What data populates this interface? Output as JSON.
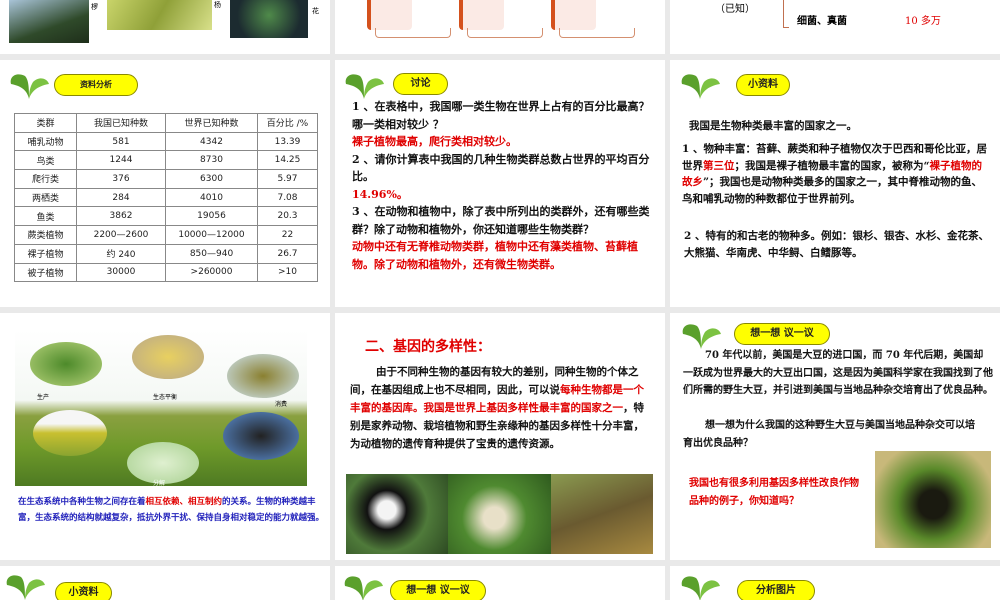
{
  "row1": {
    "slide1": {
      "labels": [
        "椤",
        "杨",
        "花"
      ]
    },
    "slide3": {
      "known": "（已知）",
      "item": "细菌、真菌",
      "count": "10 多万"
    }
  },
  "slide_table": {
    "badge": "资料分析",
    "headers": [
      "类群",
      "我国已知种数",
      "世界已知种数",
      "百分比 /%"
    ],
    "rows": [
      [
        "哺乳动物",
        "581",
        "4342",
        "13.39"
      ],
      [
        "鸟类",
        "1244",
        "8730",
        "14.25"
      ],
      [
        "爬行类",
        "376",
        "6300",
        "5.97"
      ],
      [
        "两栖类",
        "284",
        "4010",
        "7.08"
      ],
      [
        "鱼类",
        "3862",
        "19056",
        "20.3"
      ],
      [
        "蕨类植物",
        "2200—2600",
        "10000—12000",
        "22"
      ],
      [
        "裸子植物",
        "约 240",
        "850—940",
        "26.7"
      ],
      [
        "被子植物",
        "30000",
        ">260000",
        ">10"
      ]
    ]
  },
  "slide_discuss": {
    "badge": "讨论",
    "q1": "1 、在表格中，我国哪一类生物在世界上占有的百分比最高？哪一类相对较少 ？",
    "a1": "裸子植物最高，爬行类相对较少。",
    "q2": "2 、请你计算表中我国的几种生物类群总数占世界的平均百分比。",
    "a2": "14.96%。",
    "q3": "3 、在动物和植物中，除了表中所列出的类群外，还有哪些类群？除了动物和植物外，你还知道哪些生物类群？",
    "a3": "动物中还有无脊椎动物类群，植物中还有藻类植物、苔藓植物。除了动物和植物外，还有微生物类群。"
  },
  "slide_info": {
    "badge": "小资料",
    "intro": "我国是生物种类最丰富的国家之一。",
    "p1a": "1 、物种丰富：苔藓、蕨类和种子植物仅次于巴西和哥伦比亚，居世界",
    "p1b": "第三位",
    "p1c": "；我国是裸子植物最丰富的国家，被称为“",
    "p1d": "裸子植物的故乡",
    "p1e": "”；我国也是动物种类最多的国家之一，其中脊椎动物的鱼、鸟和哺乳动物的种数都位于世界前列。",
    "p2": "2 、特有的和古老的物种多。例如：银杉、银杏、水杉、金花茶、大熊猫、华南虎、中华鲟、白鳍豚等。"
  },
  "slide_eco": {
    "labels": {
      "producer": "生产",
      "balance": "生态平衡",
      "consumer": "消费",
      "decomposer": "分解"
    },
    "cap_a": "在生态系统中各种生物之间存在着",
    "cap_b": "相互依赖、相互制约",
    "cap_c": "的关系。生物的种类越丰富，生态系统的结构就越复杂，抵抗外界干扰、保持自身相对稳定的能力就越强。"
  },
  "slide_gene": {
    "title": "二、基因的多样性：",
    "p_a": "由于不同种生物的基因有较大的差别，同种生物的个体之间，在基因组成上也不尽相同，因此，可以说",
    "p_b": "每种生物都是一个丰富的基因库。我国是世界上基因多样性最丰富的国家之一",
    "p_c": "，特别是家养动物、栽培植物和野生亲缘种的基因多样性十分丰富，为动植物的遗传育种提供了宝贵的遗传资源。"
  },
  "slide_think": {
    "badge": "想一想 议一议",
    "p1": "70 年代以前，美国是大豆的进口国，而 70 年代后期，美国却一跃成为世界最大的大豆出口国，这是因为美国科学家在我国找到了他们所需的野生大豆，并引进到美国与当地品种杂交培育出了优良品种。",
    "p2": "想一想为什么我国的这种野生大豆与美国当地品种杂交可以培育出优良品种？",
    "red": "我国也有很多利用基因多样性改良作物品种的例子，你知道吗？"
  },
  "row4": {
    "badges": [
      "小资料",
      "想一想 议一议",
      "分析图片"
    ]
  },
  "colors": {
    "badge": "#ffff00",
    "red": "#e00000",
    "blue": "#2222bb",
    "gap": "#e9e9e9"
  }
}
